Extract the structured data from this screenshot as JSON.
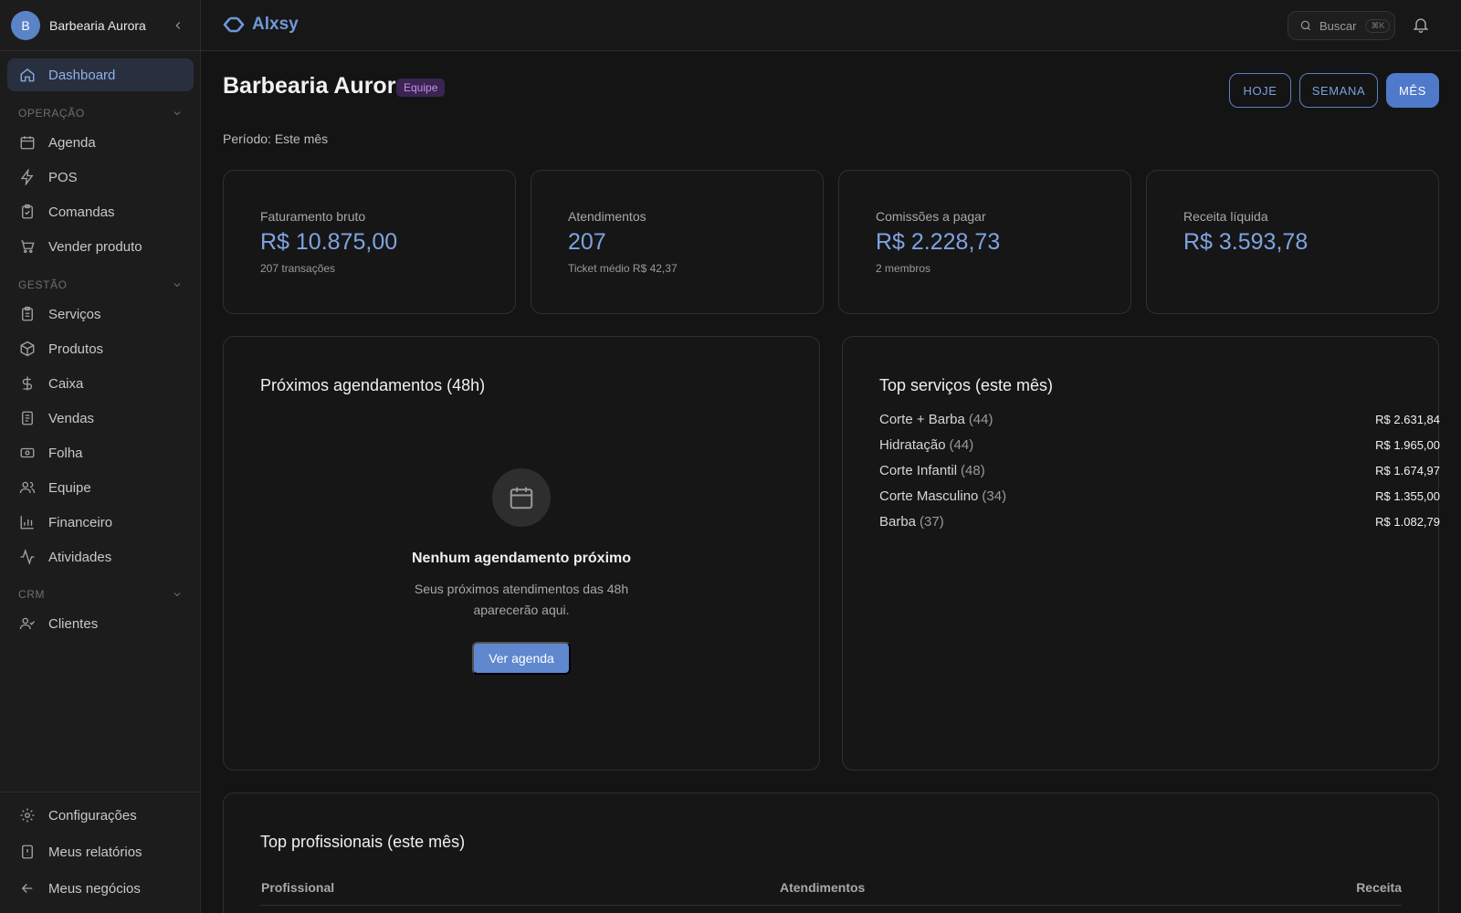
{
  "colors": {
    "accent": "#4f79c9",
    "accent_text": "#7fa3e2",
    "badge_bg": "#3a2450",
    "badge_text": "#c78ef0",
    "background": "#141414",
    "sidebar_bg": "#1c1c1c"
  },
  "sidebar": {
    "avatar_initial": "B",
    "business_name": "Barbearia Aurora",
    "dashboard": {
      "label": "Dashboard",
      "icon": "home-icon"
    },
    "sections": [
      {
        "label": "OPERAÇÃO",
        "items": [
          {
            "label": "Agenda",
            "icon": "calendar-icon"
          },
          {
            "label": "POS",
            "icon": "zap-icon"
          },
          {
            "label": "Comandas",
            "icon": "clipboard-check-icon"
          },
          {
            "label": "Vender produto",
            "icon": "cart-icon"
          }
        ]
      },
      {
        "label": "GESTÃO",
        "items": [
          {
            "label": "Serviços",
            "icon": "clipboard-list-icon"
          },
          {
            "label": "Produtos",
            "icon": "package-icon"
          },
          {
            "label": "Caixa",
            "icon": "dollar-icon"
          },
          {
            "label": "Vendas",
            "icon": "receipt-icon"
          },
          {
            "label": "Folha",
            "icon": "banknote-icon"
          },
          {
            "label": "Equipe",
            "icon": "users-icon"
          },
          {
            "label": "Financeiro",
            "icon": "bar-chart-icon"
          },
          {
            "label": "Atividades",
            "icon": "activity-icon"
          }
        ]
      },
      {
        "label": "CRM",
        "items": [
          {
            "label": "Clientes",
            "icon": "user-check-icon"
          }
        ]
      }
    ],
    "footer": [
      {
        "label": "Configurações",
        "icon": "settings-icon"
      },
      {
        "label": "Meus relatórios",
        "icon": "file-alert-icon"
      },
      {
        "label": "Meus negócios",
        "icon": "arrow-left-icon"
      }
    ]
  },
  "topbar": {
    "brand": "Alxsy",
    "search_label": "Buscar",
    "search_shortcut": "⌘K"
  },
  "header": {
    "title": "Barbearia Aurora",
    "badge": "Equipe",
    "period": "Período: Este mês",
    "ranges": [
      "HOJE",
      "SEMANA",
      "MÊS"
    ],
    "active_range": "MÊS"
  },
  "stats": [
    {
      "label": "Faturamento bruto",
      "value": "R$ 10.875,00",
      "sub": "207 transações"
    },
    {
      "label": "Atendimentos",
      "value": "207",
      "sub": "Ticket médio R$ 42,37"
    },
    {
      "label": "Comissões a pagar",
      "value": "R$ 2.228,73",
      "sub": "2 membros"
    },
    {
      "label": "Receita líquida",
      "value": "R$ 3.593,78",
      "sub": ""
    }
  ],
  "appointments": {
    "title": "Próximos agendamentos (48h)",
    "empty_title": "Nenhum agendamento próximo",
    "empty_desc": "Seus próximos atendimentos das 48h aparecerão aqui.",
    "cta": "Ver agenda"
  },
  "top_services": {
    "title": "Top serviços (este mês)",
    "rows": [
      {
        "name": "Corte + Barba",
        "count": "(44)",
        "amount": "R$ 2.631,84"
      },
      {
        "name": "Hidratação",
        "count": "(44)",
        "amount": "R$ 1.965,00"
      },
      {
        "name": "Corte Infantil",
        "count": "(48)",
        "amount": "R$ 1.674,97"
      },
      {
        "name": "Corte Masculino",
        "count": "(34)",
        "amount": "R$ 1.355,00"
      },
      {
        "name": "Barba",
        "count": "(37)",
        "amount": "R$ 1.082,79"
      }
    ]
  },
  "top_professionals": {
    "title": "Top profissionais (este mês)",
    "columns": [
      "Profissional",
      "Atendimentos",
      "Receita"
    ]
  }
}
